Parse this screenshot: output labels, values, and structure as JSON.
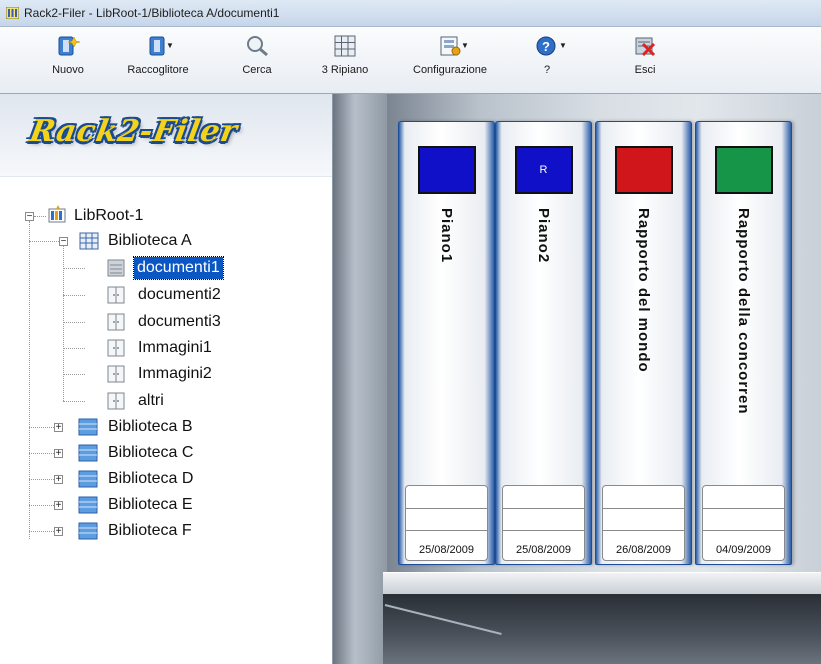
{
  "window": {
    "title": "Rack2-Filer - LibRoot-1/Biblioteca A/documenti1"
  },
  "toolbar": [
    {
      "name": "new",
      "label": "Nuovo",
      "icon": "new-binder-icon",
      "dropdown": false
    },
    {
      "name": "binder",
      "label": "Raccoglitore",
      "icon": "binder-icon",
      "dropdown": true
    },
    {
      "name": "search",
      "label": "Cerca",
      "icon": "search-icon",
      "dropdown": false
    },
    {
      "name": "shelf",
      "label": "3 Ripiano",
      "icon": "shelf-grid-icon",
      "dropdown": false
    },
    {
      "name": "config",
      "label": "Configurazione",
      "icon": "configuration-icon",
      "dropdown": true
    },
    {
      "name": "help",
      "label": "?",
      "icon": "help-icon",
      "dropdown": true
    },
    {
      "name": "exit",
      "label": "Esci",
      "icon": "exit-icon",
      "dropdown": false
    }
  ],
  "logo": {
    "text": "Rack2-Filer"
  },
  "tree": {
    "root": "LibRoot-1",
    "library_a": "Biblioteca A",
    "cabinets": [
      "documenti1",
      "documenti2",
      "documenti3",
      "Immagini1",
      "Immagini2",
      "altri"
    ],
    "selected": "documenti1",
    "other_libraries": [
      "Biblioteca B",
      "Biblioteca C",
      "Biblioteca D",
      "Biblioteca E",
      "Biblioteca F"
    ]
  },
  "binders": [
    {
      "title": "Piano1",
      "color": "#1010c8",
      "letter": "",
      "date": "25/08/2009"
    },
    {
      "title": "Piano2",
      "color": "#1010c8",
      "letter": "R",
      "date": "25/08/2009"
    },
    {
      "title": "Rapporto del mondo",
      "color": "#d0161a",
      "letter": "",
      "date": "26/08/2009"
    },
    {
      "title": "Rapporto della concorren",
      "color": "#169447",
      "letter": "",
      "date": "04/09/2009"
    }
  ]
}
